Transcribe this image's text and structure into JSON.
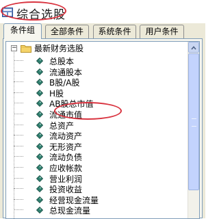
{
  "window": {
    "title": "综合选股",
    "accent": "#d9333f"
  },
  "tabs": [
    {
      "label": "条件组",
      "active": true
    },
    {
      "label": "全部条件",
      "active": false
    },
    {
      "label": "系统条件",
      "active": false
    },
    {
      "label": "用户条件",
      "active": false
    }
  ],
  "tree": {
    "expander": "−",
    "root": {
      "label": "最新财务选股",
      "icon": "folder-icon"
    },
    "items": [
      "总股本",
      "流通股本",
      "B股/A股",
      "H股",
      "AB股总市值",
      "流通市值",
      "总资产",
      "流动资产",
      "无形资产",
      "流动负债",
      "应收帐款",
      "营业利润",
      "投资收益",
      "经营现金流量",
      "总现金流量"
    ],
    "highlighted_item": "流通市值",
    "item_icon": "diamond-bullet-icon"
  }
}
